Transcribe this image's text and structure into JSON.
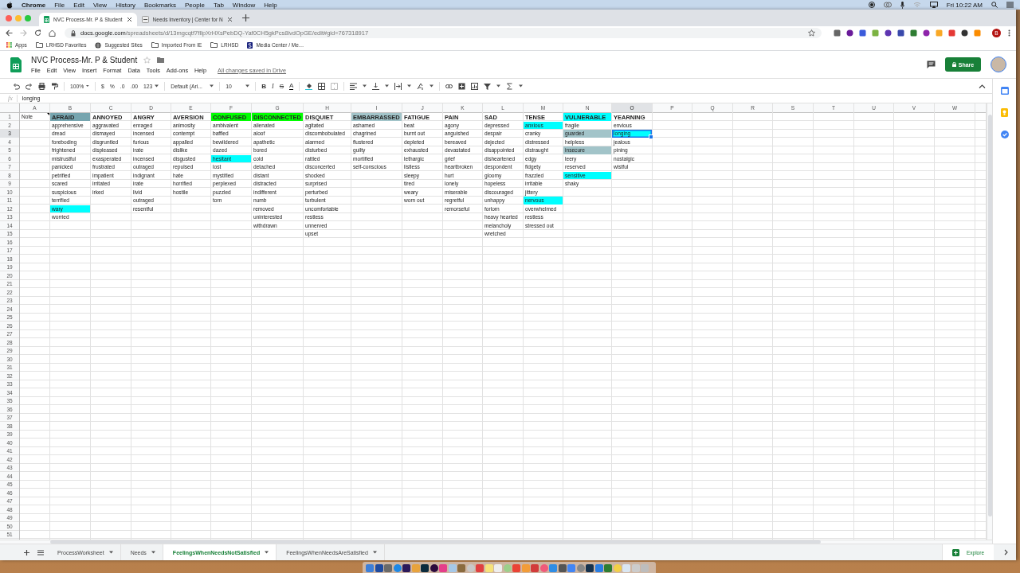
{
  "menubar": {
    "app": "Chrome",
    "menus": [
      "File",
      "Edit",
      "View",
      "History",
      "Bookmarks",
      "People",
      "Tab",
      "Window",
      "Help"
    ],
    "clock": "Fri 10:22 AM"
  },
  "browser": {
    "tabs": [
      {
        "title": "NVC Process-Mr. P & Student",
        "selected": true
      },
      {
        "title": "Needs Inventory | Center for N",
        "selected": false
      }
    ],
    "url": {
      "host": "docs.google.com",
      "path": "/spreadsheets/d/13mgcqtf7fIlpXrHXsPebDQ-Yaf0CH5gkPcs8ivdOpGE/edit#gid=767318917"
    },
    "profile_initial": "B",
    "bookmarks": [
      {
        "label": "Apps",
        "kind": "apps"
      },
      {
        "label": "LRHSD Favorites",
        "kind": "folder"
      },
      {
        "label": "Suggested Sites",
        "kind": "globe"
      },
      {
        "label": "Imported From IE",
        "kind": "folder"
      },
      {
        "label": "LRHSD",
        "kind": "folder"
      },
      {
        "label": "Media Center / Me…",
        "kind": "site"
      }
    ]
  },
  "document": {
    "title": "NVC Process-Mr. P & Student",
    "menus": [
      "File",
      "Edit",
      "View",
      "Insert",
      "Format",
      "Data",
      "Tools",
      "Add-ons",
      "Help"
    ],
    "save_status": "All changes saved in Drive",
    "share_label": "Share"
  },
  "toolbar": {
    "zoom": "100%",
    "currency": "$",
    "percent": "%",
    "decimal_decrease": ".0",
    "decimal_increase": ".00",
    "number_format": "123",
    "font": "Default (Ari...",
    "font_size": "10",
    "bold": "B",
    "italic": "I",
    "strikethrough": "S",
    "text_color": "A"
  },
  "formula_bar": {
    "label": "fx",
    "content": "longing"
  },
  "grid": {
    "column_headers": [
      "A",
      "B",
      "C",
      "D",
      "E",
      "F",
      "G",
      "H",
      "I",
      "J",
      "K",
      "L",
      "M",
      "N",
      "O",
      "P",
      "Q",
      "R",
      "S",
      "T",
      "U",
      "V",
      "W"
    ],
    "row_numbers": [
      "1",
      "2",
      "3",
      "4",
      "5",
      "6",
      "7",
      "8",
      "9",
      "10",
      "11",
      "12",
      "13",
      "14",
      "15",
      "16",
      "17",
      "18",
      "19",
      "20",
      "21",
      "22",
      "23",
      "24",
      "25",
      "26",
      "27",
      "28",
      "29",
      "30",
      "31",
      "32",
      "33",
      "34",
      "35",
      "36",
      "37",
      "38",
      "39",
      "40",
      "41",
      "42",
      "43",
      "44",
      "45",
      "46",
      "47",
      "48",
      "49",
      "50",
      "51"
    ],
    "columns": [
      {
        "cells": [
          {
            "text": "Note",
            "selected": false,
            "note": true
          }
        ]
      },
      {
        "heading": {
          "text": "AFRAID",
          "selected": false,
          "color": "#76a5af"
        },
        "cells": [
          {
            "text": "apprehensive",
            "selected": false
          },
          {
            "text": "dread",
            "selected": false
          },
          {
            "text": "foreboding",
            "selected": false
          },
          {
            "text": "frightened",
            "selected": false
          },
          {
            "text": "mistrustful",
            "selected": false
          },
          {
            "text": "panicked",
            "selected": false
          },
          {
            "text": "petrified",
            "selected": false
          },
          {
            "text": "scared",
            "selected": false
          },
          {
            "text": "suspicious",
            "selected": false
          },
          {
            "text": "terrified",
            "selected": false
          },
          {
            "text": "wary",
            "selected": false,
            "color": "#00ffff"
          },
          {
            "text": "worried",
            "selected": false
          }
        ]
      },
      {
        "heading": {
          "text": "ANNOYED",
          "selected": false
        },
        "cells": [
          {
            "text": "aggravated",
            "selected": false
          },
          {
            "text": "dismayed",
            "selected": false
          },
          {
            "text": "disgruntled",
            "selected": false
          },
          {
            "text": "displeased",
            "selected": false
          },
          {
            "text": "exasperated",
            "selected": false
          },
          {
            "text": "frustrated",
            "selected": false
          },
          {
            "text": "impatient",
            "selected": false
          },
          {
            "text": "irritated",
            "selected": false
          },
          {
            "text": "irked",
            "selected": false
          }
        ]
      },
      {
        "heading": {
          "text": "ANGRY",
          "selected": false
        },
        "cells": [
          {
            "text": "enraged",
            "selected": false
          },
          {
            "text": "incensed",
            "selected": false
          },
          {
            "text": "furious",
            "selected": false
          },
          {
            "text": "irate",
            "selected": false
          },
          {
            "text": "incensed",
            "selected": false
          },
          {
            "text": "outraged",
            "selected": false
          },
          {
            "text": "indignant",
            "selected": false
          },
          {
            "text": "irate",
            "selected": false
          },
          {
            "text": "livid",
            "selected": false
          },
          {
            "text": "outraged",
            "selected": false
          },
          {
            "text": "resentful",
            "selected": false
          }
        ]
      },
      {
        "heading": {
          "text": "AVERSION",
          "selected": false
        },
        "cells": [
          {
            "text": "animosity",
            "selected": false
          },
          {
            "text": "contempt",
            "selected": false
          },
          {
            "text": "appalled",
            "selected": false
          },
          {
            "text": "dislike",
            "selected": false
          },
          {
            "text": "disgusted",
            "selected": false
          },
          {
            "text": "repulsed",
            "selected": false
          },
          {
            "text": "hate",
            "selected": false
          },
          {
            "text": "horrified",
            "selected": false
          },
          {
            "text": "hostile",
            "selected": false
          }
        ]
      },
      {
        "heading": {
          "text": "CONFUSED",
          "selected": false,
          "color": "#00ff00"
        },
        "cells": [
          {
            "text": "ambivalent",
            "selected": false
          },
          {
            "text": "baffled",
            "selected": false
          },
          {
            "text": "bewildered",
            "selected": false
          },
          {
            "text": "dazed",
            "selected": false
          },
          {
            "text": "hesitant",
            "selected": false,
            "color": "#00ffff"
          },
          {
            "text": "lost",
            "selected": false
          },
          {
            "text": "mystified",
            "selected": false
          },
          {
            "text": "perplexed",
            "selected": false
          },
          {
            "text": "puzzled",
            "selected": false
          },
          {
            "text": "torn",
            "selected": false
          }
        ]
      },
      {
        "heading": {
          "text": "DISCONNECTED",
          "selected": false,
          "color": "#00ff00"
        },
        "cells": [
          {
            "text": "alienated",
            "selected": false
          },
          {
            "text": "aloof",
            "selected": false
          },
          {
            "text": "apathetic",
            "selected": false
          },
          {
            "text": "bored",
            "selected": false
          },
          {
            "text": "cold",
            "selected": false
          },
          {
            "text": "detached",
            "selected": false
          },
          {
            "text": "distant",
            "selected": false
          },
          {
            "text": "distracted",
            "selected": false
          },
          {
            "text": "indifferent",
            "selected": false
          },
          {
            "text": "numb",
            "selected": false
          },
          {
            "text": "removed",
            "selected": false
          },
          {
            "text": "uninterested",
            "selected": false
          },
          {
            "text": "withdrawn",
            "selected": false
          }
        ]
      },
      {
        "heading": {
          "text": "DISQUIET",
          "selected": false
        },
        "cells": [
          {
            "text": "agitated",
            "selected": false
          },
          {
            "text": "discombobulated",
            "selected": false
          },
          {
            "text": "alarmed",
            "selected": false
          },
          {
            "text": "disturbed",
            "selected": false
          },
          {
            "text": "rattled",
            "selected": false
          },
          {
            "text": "disconcerted",
            "selected": false
          },
          {
            "text": "shocked",
            "selected": false
          },
          {
            "text": "surprised",
            "selected": false
          },
          {
            "text": "perturbed",
            "selected": false
          },
          {
            "text": "turbulent",
            "selected": false
          },
          {
            "text": "uncomfortable",
            "selected": false
          },
          {
            "text": "restless",
            "selected": false
          },
          {
            "text": "unnerved",
            "selected": false
          },
          {
            "text": "upset",
            "selected": false
          }
        ]
      },
      {
        "heading": {
          "text": "EMBARRASSED",
          "selected": false,
          "color": "#a2c4c9"
        },
        "cells": [
          {
            "text": "ashamed",
            "selected": false
          },
          {
            "text": "chagrined",
            "selected": false
          },
          {
            "text": "flustered",
            "selected": false
          },
          {
            "text": "guilty",
            "selected": false
          },
          {
            "text": "mortified",
            "selected": false
          },
          {
            "text": "self-conscious",
            "selected": false
          }
        ]
      },
      {
        "heading": {
          "text": "FATIGUE",
          "selected": false
        },
        "cells": [
          {
            "text": "beat",
            "selected": false
          },
          {
            "text": "burnt out",
            "selected": false
          },
          {
            "text": "depleted",
            "selected": false
          },
          {
            "text": "exhausted",
            "selected": false
          },
          {
            "text": "lethargic",
            "selected": false
          },
          {
            "text": "listless",
            "selected": false
          },
          {
            "text": "sleepy",
            "selected": false
          },
          {
            "text": "tired",
            "selected": false
          },
          {
            "text": "weary",
            "selected": false
          },
          {
            "text": "worn out",
            "selected": false
          }
        ]
      },
      {
        "heading": {
          "text": "PAIN",
          "selected": false
        },
        "cells": [
          {
            "text": "agony",
            "selected": false
          },
          {
            "text": "anguished",
            "selected": false
          },
          {
            "text": "bereaved",
            "selected": false
          },
          {
            "text": "devastated",
            "selected": false
          },
          {
            "text": "grief",
            "selected": false
          },
          {
            "text": "heartbroken",
            "selected": false
          },
          {
            "text": "hurt",
            "selected": false
          },
          {
            "text": "lonely",
            "selected": false
          },
          {
            "text": "miserable",
            "selected": false
          },
          {
            "text": "regretful",
            "selected": false
          },
          {
            "text": "remorseful",
            "selected": false
          }
        ]
      },
      {
        "heading": {
          "text": "SAD",
          "selected": false
        },
        "cells": [
          {
            "text": "depressed",
            "selected": false
          },
          {
            "text": "despair",
            "selected": false
          },
          {
            "text": "dejected",
            "selected": false
          },
          {
            "text": "disappointed",
            "selected": false
          },
          {
            "text": "disheartened",
            "selected": false
          },
          {
            "text": "despondent",
            "selected": false
          },
          {
            "text": "gloomy",
            "selected": false
          },
          {
            "text": "hopeless",
            "selected": false
          },
          {
            "text": "discouraged",
            "selected": false
          },
          {
            "text": "unhappy",
            "selected": false
          },
          {
            "text": "forlorn",
            "selected": false
          },
          {
            "text": "heavy hearted",
            "selected": false
          },
          {
            "text": "melancholy",
            "selected": false
          },
          {
            "text": "wretched",
            "selected": false
          }
        ]
      },
      {
        "heading": {
          "text": "TENSE",
          "selected": false
        },
        "cells": [
          {
            "text": "anxious",
            "selected": false,
            "color": "#00ffff"
          },
          {
            "text": "cranky",
            "selected": false
          },
          {
            "text": "distressed",
            "selected": false
          },
          {
            "text": "distraught",
            "selected": false
          },
          {
            "text": "edgy",
            "selected": false
          },
          {
            "text": "fidgety",
            "selected": false
          },
          {
            "text": "frazzled",
            "selected": false
          },
          {
            "text": "irritable",
            "selected": false
          },
          {
            "text": "jittery",
            "selected": false
          },
          {
            "text": "nervous",
            "selected": false,
            "color": "#00ffff"
          },
          {
            "text": "overwhelmed",
            "selected": false
          },
          {
            "text": "restless",
            "selected": false
          },
          {
            "text": "stressed out",
            "selected": false
          }
        ]
      },
      {
        "heading": {
          "text": "VULNERABLE",
          "selected": false,
          "color": "#00ffff"
        },
        "cells": [
          {
            "text": "fragile",
            "selected": false
          },
          {
            "text": "guarded",
            "selected": false,
            "color": "#a2c4c9"
          },
          {
            "text": "helpless",
            "selected": false
          },
          {
            "text": "insecure",
            "selected": false,
            "color": "#a2c4c9"
          },
          {
            "text": "leery",
            "selected": false
          },
          {
            "text": "reserved",
            "selected": false
          },
          {
            "text": "sensitive",
            "selected": false,
            "color": "#00ffff"
          },
          {
            "text": "shaky",
            "selected": false
          }
        ]
      },
      {
        "heading": {
          "text": "YEARNING",
          "selected": false
        },
        "cells": [
          {
            "text": "envious",
            "selected": false
          },
          {
            "text": "longing",
            "selected": true,
            "color": "#00ffff"
          },
          {
            "text": "jealous",
            "selected": false
          },
          {
            "text": "pining",
            "selected": false
          },
          {
            "text": "nostalgic",
            "selected": false
          },
          {
            "text": "wistful",
            "selected": false
          }
        ]
      }
    ]
  },
  "sheet_tabs": [
    {
      "label": "ProcessWorksheet",
      "selected": false
    },
    {
      "label": "Needs",
      "selected": false
    },
    {
      "label": "FeelingsWhenNeedsNotSatisfied",
      "selected": true
    },
    {
      "label": "FeelingsWhenNeedsAreSatisfied",
      "selected": false
    }
  ],
  "explore_label": "Explore"
}
